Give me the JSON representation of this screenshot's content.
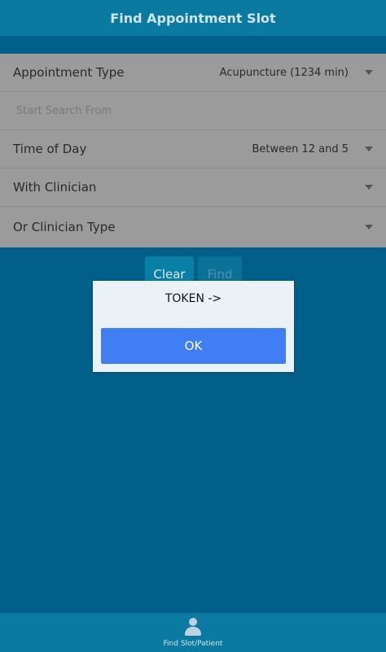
{
  "header": {
    "title": "Find Appointment Slot"
  },
  "form": {
    "appointment_type": {
      "label": "Appointment Type",
      "value": "Acupuncture (1234 min)"
    },
    "start_search": {
      "placeholder": "Start Search From"
    },
    "time_of_day": {
      "label": "Time of Day",
      "value": "Between 12 and 5"
    },
    "with_clinician": {
      "label": "With Clinician"
    },
    "clinician_type": {
      "label": "Or Clinician Type"
    }
  },
  "actions": {
    "clear_label": "Clear",
    "find_label": "Find"
  },
  "dialog": {
    "message": "TOKEN ->",
    "ok_label": "OK"
  },
  "footer": {
    "nav_label": "Find Slot/Patient",
    "nav_icon": "person-icon"
  },
  "colors": {
    "header": "#0a7aa0",
    "background": "#025f89",
    "form_bg": "#9b9b9b",
    "ok_button": "#3f7ef5"
  }
}
